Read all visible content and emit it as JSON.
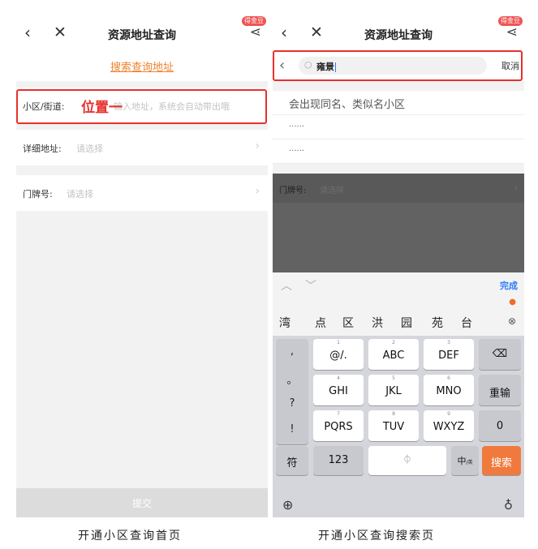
{
  "left": {
    "header": {
      "title": "资源地址查询",
      "badge": "得金豆"
    },
    "search_link": "搜索查询地址",
    "rows": [
      {
        "label": "小区/街道:",
        "placeholder": "输入地址，系统会自动带出哦"
      },
      {
        "label": "详细地址:",
        "placeholder": "请选择"
      },
      {
        "label": "门牌号:",
        "placeholder": "请选择"
      }
    ],
    "annotation": "位置一",
    "submit": "提交",
    "caption": "开通小区查询首页"
  },
  "right": {
    "header": {
      "title": "资源地址查询",
      "badge": "得金豆"
    },
    "search": {
      "value": "雍景",
      "cancel": "取消"
    },
    "results": [
      "会出现同名、类似名小区",
      "......",
      "......"
    ],
    "dim_row": {
      "label": "门牌号:",
      "placeholder": "请选择"
    },
    "keyboard": {
      "done": "完成",
      "candidates": [
        "湾",
        "点",
        "区",
        "洪",
        "园",
        "苑",
        "台"
      ],
      "punct": [
        ",",
        "。",
        "?",
        "!"
      ],
      "rows": [
        [
          {
            "num": "1",
            "label": "@/."
          },
          {
            "num": "2",
            "label": "ABC"
          },
          {
            "num": "3",
            "label": "DEF"
          }
        ],
        [
          {
            "num": "4",
            "label": "GHI"
          },
          {
            "num": "5",
            "label": "JKL"
          },
          {
            "num": "6",
            "label": "MNO"
          }
        ],
        [
          {
            "num": "7",
            "label": "PQRS"
          },
          {
            "num": "8",
            "label": "TUV"
          },
          {
            "num": "9",
            "label": "WXYZ"
          }
        ]
      ],
      "delete": "⌫",
      "reinput": "重输",
      "zero": "0",
      "symbols": "符",
      "num_switch": "123",
      "space_icon": "mic-icon",
      "lang": "中",
      "lang_sub": "/英",
      "search": "搜索"
    },
    "caption": "开通小区查询搜索页"
  },
  "icons": {
    "accent": "#f0822d",
    "highlight": "#e8302b",
    "link": "#2d7cf6"
  }
}
